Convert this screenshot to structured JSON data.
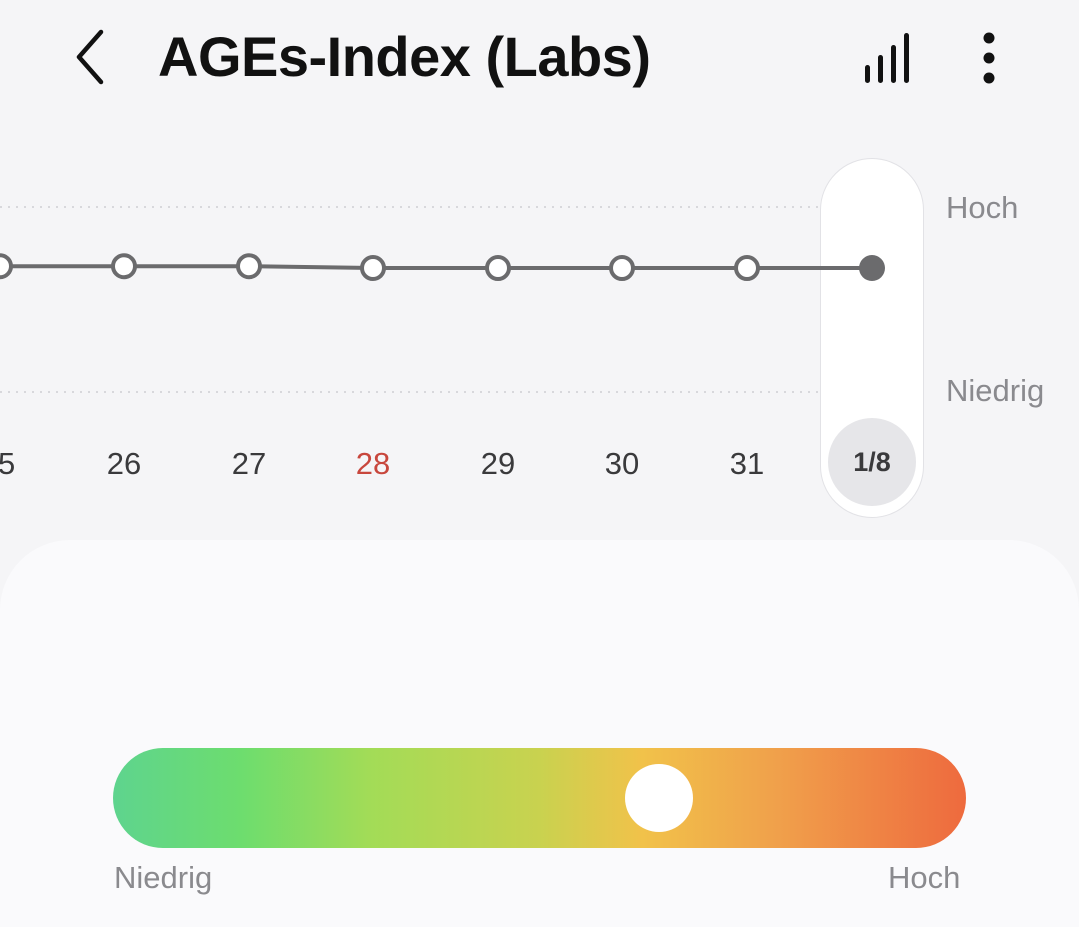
{
  "header": {
    "title": "AGEs-Index (Labs)",
    "back_icon": "chevron-left-icon",
    "stats_icon": "bar-chart-icon",
    "more_icon": "more-vertical-icon"
  },
  "chart_data": {
    "type": "line",
    "x": [
      "5",
      "26",
      "27",
      "28",
      "29",
      "30",
      "31",
      "1/8"
    ],
    "values": [
      0.68,
      0.68,
      0.68,
      0.67,
      0.67,
      0.67,
      0.67,
      0.67
    ],
    "y_axis_labels": {
      "top": "Hoch",
      "bottom": "Niedrig"
    },
    "highlighted_x": "28",
    "selected_x": "1/8",
    "colors": {
      "line": "#6b6b6d",
      "highlight": "#c8473d",
      "grid": "#d8d8dc"
    }
  },
  "chart": {
    "label_high": "Hoch",
    "label_low": "Niedrig",
    "dates": [
      "5",
      "26",
      "27",
      "28",
      "29",
      "30",
      "31"
    ],
    "selected_date": "1/8"
  },
  "gauge": {
    "label_low": "Niedrig",
    "label_high": "Hoch",
    "level": 0.64
  }
}
